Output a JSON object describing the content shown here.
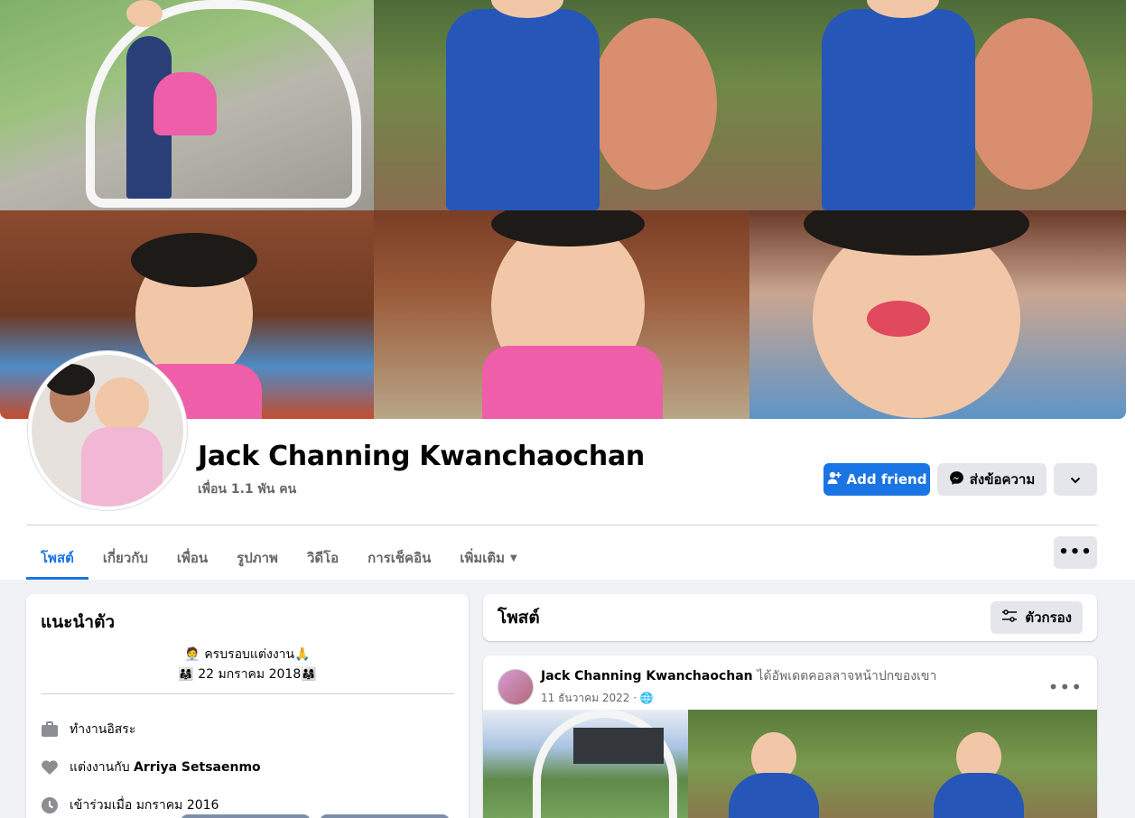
{
  "profile": {
    "name": "Jack Channing Kwanchaochan",
    "friends_count": "เพื่อน 1.1 พัน คน"
  },
  "actions": {
    "add_friend": "Add friend",
    "message": "ส่งข้อความ"
  },
  "tabs": [
    {
      "label": "โพสต์",
      "active": true
    },
    {
      "label": "เกี่ยวกับ"
    },
    {
      "label": "เพื่อน"
    },
    {
      "label": "รูปภาพ"
    },
    {
      "label": "วิดีโอ"
    },
    {
      "label": "การเช็คอิน"
    },
    {
      "label": "เพิ่มเติม"
    }
  ],
  "intro": {
    "title": "แนะนำตัว",
    "bio_line1": "ครบรอบแต่งงาน",
    "bio_line2": "22 มกราคม 2018",
    "work": "ทำงานอิสระ",
    "married_prefix": "แต่งงานกับ",
    "married_name": "Arriya Setsaenmo",
    "joined": "เข้าร่วมเมื่อ มกราคม 2016"
  },
  "posts_header": {
    "title": "โพสต์",
    "filter_label": "ตัวกรอง"
  },
  "post": {
    "author": "Jack Channing Kwanchaochan",
    "action": "ได้อัพเดตคอลลาจหน้าปกของเขา",
    "date": "11 ธันวาคม 2022 ·"
  },
  "colors": {
    "accent": "#1b74e4",
    "background": "#f0f2f5",
    "secondary_text": "#65676b"
  }
}
